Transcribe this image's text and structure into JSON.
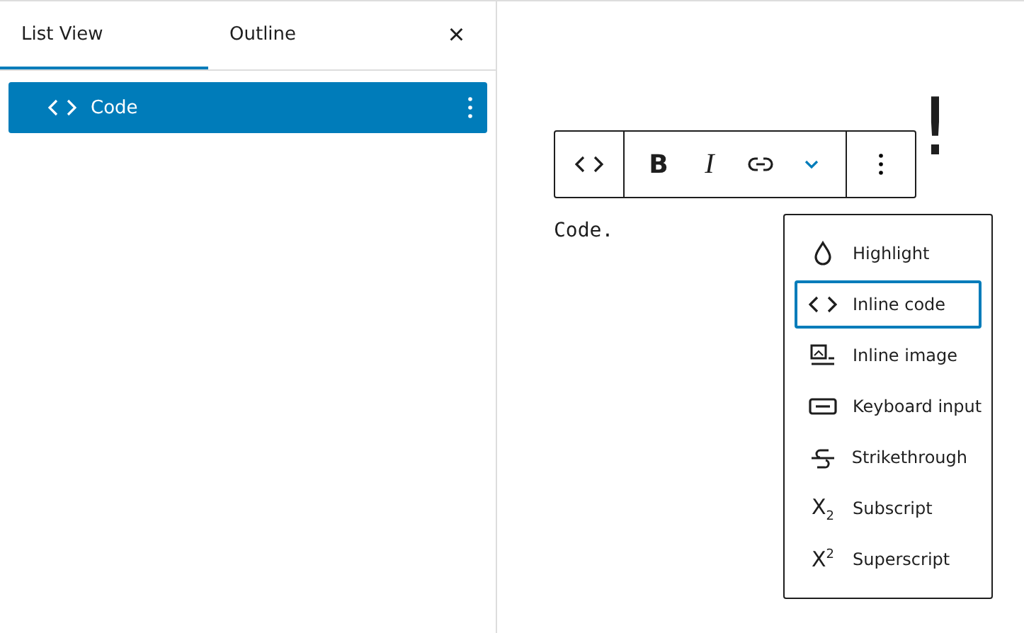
{
  "sidebar": {
    "tabs": [
      {
        "label": "List View",
        "selected": true
      },
      {
        "label": "Outline",
        "selected": false
      }
    ],
    "close": "×",
    "items": [
      {
        "label": "Code",
        "selected": true
      }
    ]
  },
  "editor": {
    "heading": "!",
    "paragraph": "Code.",
    "toolbar": [
      {
        "kind": "code"
      },
      {
        "kind": "bold",
        "label": "B"
      },
      {
        "kind": "italic",
        "label": "I"
      },
      {
        "kind": "link"
      },
      {
        "kind": "chevron"
      },
      {
        "kind": "more"
      }
    ],
    "menu": [
      {
        "kind": "drop",
        "label": "Highlight",
        "selected": false
      },
      {
        "kind": "code",
        "label": "Inline code",
        "selected": true
      },
      {
        "kind": "image",
        "label": "Inline image",
        "selected": false
      },
      {
        "kind": "keyboard",
        "label": "Keyboard input",
        "selected": false
      },
      {
        "kind": "strike",
        "label": "Strikethrough",
        "selected": false
      },
      {
        "kind": "glyph",
        "glyph": "X$_{2}$",
        "label": "Subscript",
        "selected": false
      },
      {
        "kind": "glyph",
        "glyph": "X$^{2}$",
        "label": "Superscript",
        "selected": false
      }
    ]
  }
}
